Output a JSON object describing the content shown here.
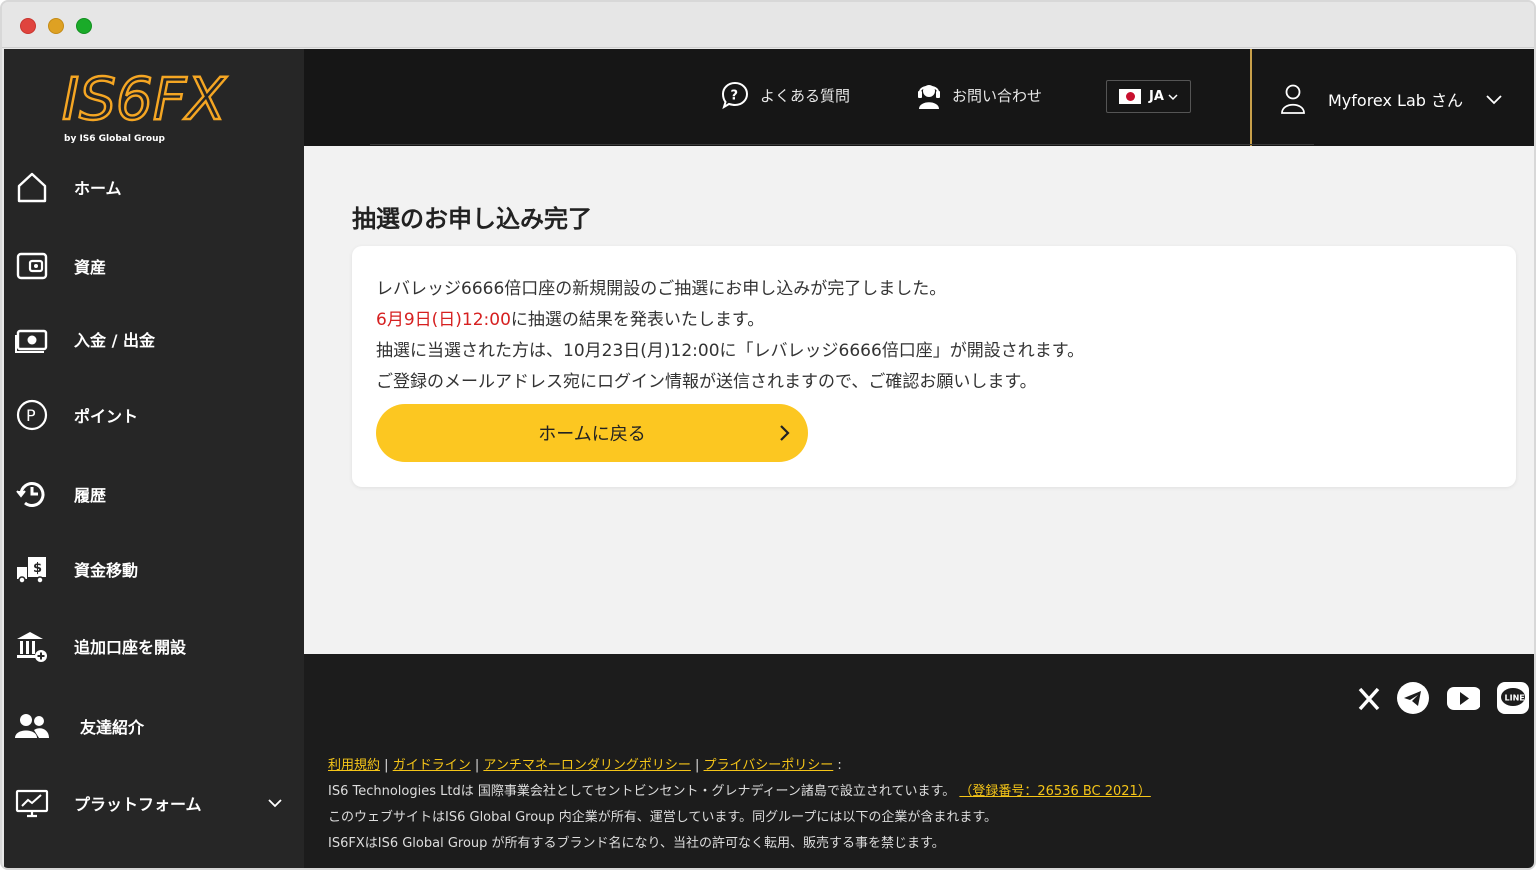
{
  "logo": {
    "text": "IS6FX",
    "sub": "by IS6 Global Group"
  },
  "sidebar": {
    "items": [
      {
        "label": "ホーム",
        "icon": "home-icon"
      },
      {
        "label": "資産",
        "icon": "wallet-icon"
      },
      {
        "label": "入金 / 出金",
        "icon": "cash-icon"
      },
      {
        "label": "ポイント",
        "icon": "points-icon"
      },
      {
        "label": "履歴",
        "icon": "history-icon"
      },
      {
        "label": "資金移動",
        "icon": "transfer-icon"
      },
      {
        "label": "追加口座を開設",
        "icon": "bank-add-icon"
      },
      {
        "label": "友達紹介",
        "icon": "friends-icon"
      },
      {
        "label": "プラットフォーム",
        "icon": "monitor-icon"
      }
    ]
  },
  "header": {
    "faq": "よくある質問",
    "contact": "お問い合わせ",
    "lang": "JA",
    "user": "Myforex Lab さん"
  },
  "main": {
    "title": "抽選のお申し込み完了",
    "line1": "レバレッジ6666倍口座の新規開設のご抽選にお申し込みが完了しました。",
    "line2_red": "6月9日(日)12:00",
    "line2_rest": "に抽選の結果を発表いたします。",
    "line3": "抽選に当選された方は、10月23日(月)12:00に「レバレッジ6666倍口座」が開設されます。",
    "line4": "ご登録のメールアドレス宛にログイン情報が送信されますので、ご確認お願いします。",
    "button": "ホームに戻る"
  },
  "footer": {
    "links": [
      "利用規約",
      "ガイドライン",
      "アンチマネーロンダリングポリシー",
      "プライバシーポリシー"
    ],
    "sep": "|",
    "colon": ":",
    "line1": "IS6 Technologies Ltdは 国際事業会社としてセントビンセント・グレナディーン諸島で設立されています。",
    "reg": "（登録番号：26536 BC 2021）",
    "line2": "このウェブサイトはIS6 Global Group 内企業が所有、運営しています。同グループには以下の企業が含まれます。",
    "line3": "IS6FXはIS6 Global Group が所有するブランド名になり、当社の許可なく転用、販売する事を禁じます。"
  },
  "colors": {
    "accent": "#fcc721",
    "sidebar": "#262626",
    "header": "#161616",
    "red": "#d62020"
  }
}
